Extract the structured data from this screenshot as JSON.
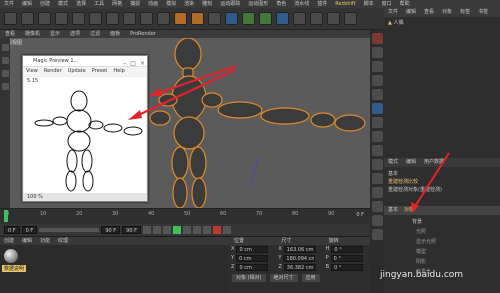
{
  "menubar": [
    "文件",
    "编辑",
    "创建",
    "模式",
    "选择",
    "工具",
    "网格",
    "捕捉",
    "动画",
    "模拟",
    "渲染",
    "雕刻",
    "运动跟踪",
    "运动图形",
    "角色",
    "流水线",
    "插件",
    "Redshift",
    "脚本",
    "窗口",
    "帮助"
  ],
  "viewport_menu": [
    "查看",
    "摄像机",
    "显示",
    "选项",
    "过滤",
    "面板",
    "ProRender"
  ],
  "viewport_label": "透视视图",
  "preview": {
    "title": "Magic Preview 1...",
    "menu": [
      "View",
      "Render",
      "Update",
      "Preset",
      "Help"
    ],
    "fps": "5.15",
    "zoom": "100 %"
  },
  "right_panel": {
    "tabs": [
      "文件",
      "编辑",
      "查看",
      "对象",
      "标签",
      "书签"
    ],
    "object_name": "人偶",
    "attr_tabs": [
      "模式",
      "编辑",
      "用户数据"
    ],
    "attr_section": "基本",
    "attr_rows": [
      "重建检测比较",
      "重建检测对象(重建检测)"
    ],
    "basic_label": "基本",
    "object_label": "对象",
    "prop_rows": [
      "背景",
      "光照",
      "显示光照",
      "模型",
      "阴影",
      "自发光"
    ]
  },
  "timeline": {
    "ticks": [
      "0",
      "10",
      "20",
      "30",
      "40",
      "50",
      "60",
      "70",
      "80",
      "90"
    ],
    "current": "0 F"
  },
  "transport": {
    "start": "0 F",
    "current": "0 F",
    "end": "90 F",
    "end2": "90 F"
  },
  "material_menu": [
    "创建",
    "编辑",
    "功能",
    "纹理"
  ],
  "material_label": "数据说明",
  "coords": {
    "headers": [
      "位置",
      "尺寸",
      "旋转"
    ],
    "rows": [
      {
        "axis": "X",
        "pos": "0 cm",
        "size": "163.06 cm",
        "rot_axis": "H",
        "rot": "0 °"
      },
      {
        "axis": "Y",
        "pos": "0 cm",
        "size": "180.094 cm",
        "rot_axis": "P",
        "rot": "0 °"
      },
      {
        "axis": "Z",
        "pos": "0 cm",
        "size": "36.382 cm",
        "rot_axis": "B",
        "rot": "0 °"
      }
    ],
    "footer": [
      "对象 (相对)",
      "绝对尺寸",
      "应用"
    ]
  },
  "watermark": "jingyan.baidu.com",
  "colors": {
    "arrow": "#e0242a",
    "figure": "#3b3b3b",
    "figure_outline": "#e08a2a",
    "accent": "#e9c46a"
  }
}
